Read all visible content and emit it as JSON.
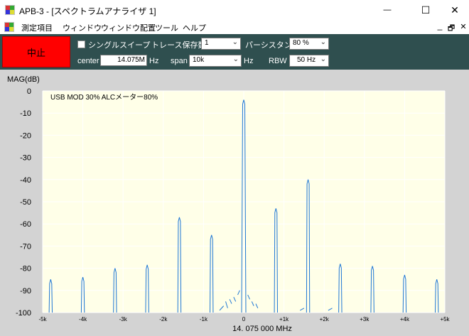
{
  "window": {
    "title": "APB-3 - [スペクトラムアナライザ 1]",
    "minimize_glyph": "—",
    "maximize_glyph": "☐",
    "close_glyph": "✕"
  },
  "menu": {
    "items": [
      {
        "label": "測定項目"
      },
      {
        "label": "ウィンドウ"
      },
      {
        "label": "ウィンドウ配置"
      },
      {
        "label": "ツール"
      },
      {
        "label": "ヘルプ"
      }
    ],
    "mdi_minimize": "_",
    "mdi_restore": "🗗",
    "mdi_close": "✕"
  },
  "controls": {
    "stop_label": "中止",
    "single_sweep_label": "シングルスイープ",
    "single_sweep_checked": false,
    "trace_count_label": "トレース保存数",
    "trace_count_value": "1",
    "persistence_label": "パーシスタンス",
    "persistence_value": "80 %",
    "center_label": "center",
    "center_value": "14.075M",
    "center_unit": "Hz",
    "span_label": "span",
    "span_value": "10k",
    "span_unit": "Hz",
    "rbw_label": "RBW",
    "rbw_value": "50 Hz"
  },
  "icons": {
    "app": "app-icon",
    "checkbox": "checkbox-icon",
    "dropdown": "chevron-down-icon"
  },
  "colors": {
    "panel": "#2f4f4f",
    "stop": "#ff0000",
    "plot_bg": "#ffffe8",
    "trace": "#1f77d4",
    "grid": "#ffffff"
  },
  "chart_data": {
    "type": "line",
    "ylabel": "MAG(dB)",
    "xlabel": "14. 075 000 MHz",
    "annotation": "USB MOD 30%  ALCメーター80%",
    "ylim": [
      -100,
      0
    ],
    "xlim": [
      -5000,
      5000
    ],
    "y_ticks": [
      0,
      -10,
      -20,
      -30,
      -40,
      -50,
      -60,
      -70,
      -80,
      -90,
      -100
    ],
    "x_ticks": [
      {
        "x": -5000,
        "label": "-5k"
      },
      {
        "x": -4000,
        "label": "-4k"
      },
      {
        "x": -3000,
        "label": "-3k"
      },
      {
        "x": -2000,
        "label": "-2k"
      },
      {
        "x": -1000,
        "label": "-1k"
      },
      {
        "x": 0,
        "label": "0"
      },
      {
        "x": 1000,
        "label": "+1k"
      },
      {
        "x": 2000,
        "label": "+2k"
      },
      {
        "x": 3000,
        "label": "+3k"
      },
      {
        "x": 4000,
        "label": "+4k"
      },
      {
        "x": 5000,
        "label": "+5k"
      }
    ],
    "grid": true,
    "peaks": [
      {
        "x": -4800,
        "y": -85
      },
      {
        "x": -4000,
        "y": -84
      },
      {
        "x": -3200,
        "y": -80
      },
      {
        "x": -2400,
        "y": -78.5
      },
      {
        "x": -1600,
        "y": -57
      },
      {
        "x": -800,
        "y": -65
      },
      {
        "x": 0,
        "y": -4
      },
      {
        "x": 800,
        "y": -53
      },
      {
        "x": 1600,
        "y": -40
      },
      {
        "x": 2400,
        "y": -78
      },
      {
        "x": 3200,
        "y": -79
      },
      {
        "x": 4000,
        "y": -83
      },
      {
        "x": 4800,
        "y": -85
      }
    ]
  }
}
